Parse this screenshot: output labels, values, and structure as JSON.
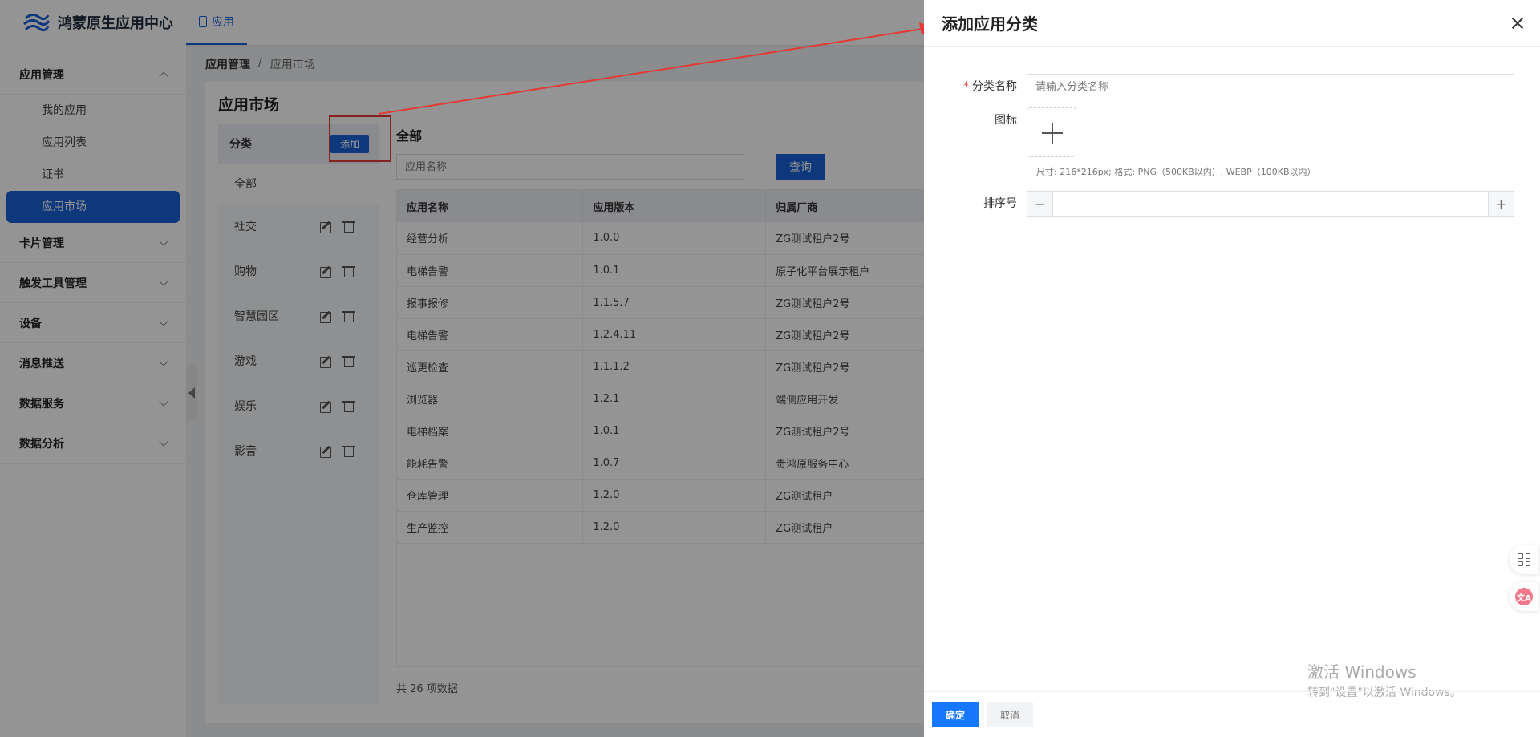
{
  "header": {
    "app_title": "鸿蒙原生应用中心",
    "tab_label": "应用"
  },
  "sidebar": {
    "groups": [
      {
        "label": "应用管理",
        "expanded": true,
        "items": [
          "我的应用",
          "应用列表",
          "证书",
          "应用市场"
        ],
        "active": "应用市场"
      },
      {
        "label": "卡片管理"
      },
      {
        "label": "触发工具管理"
      },
      {
        "label": "设备"
      },
      {
        "label": "消息推送"
      },
      {
        "label": "数据服务"
      },
      {
        "label": "数据分析"
      }
    ]
  },
  "breadcrumb": {
    "parent": "应用管理",
    "separator": "/",
    "current": "应用市场"
  },
  "main": {
    "title": "应用市场",
    "category_header": "分类",
    "add_label": "添加",
    "categories": [
      "全部",
      "社交",
      "购物",
      "智慧园区",
      "游戏",
      "娱乐",
      "影音"
    ],
    "list_title": "全部",
    "search_placeholder": "应用名称",
    "query_label": "查询",
    "columns": [
      "应用名称",
      "应用版本",
      "归属厂商"
    ],
    "rows": [
      [
        "经营分析",
        "1.0.0",
        "ZG测试租户2号"
      ],
      [
        "电梯告警",
        "1.0.1",
        "原子化平台展示租户"
      ],
      [
        "报事报修",
        "1.1.5.7",
        "ZG测试租户2号"
      ],
      [
        "电梯告警",
        "1.2.4.11",
        "ZG测试租户2号"
      ],
      [
        "巡更检查",
        "1.1.1.2",
        "ZG测试租户2号"
      ],
      [
        "浏览器",
        "1.2.1",
        "端侧应用开发"
      ],
      [
        "电梯档案",
        "1.0.1",
        "ZG测试租户2号"
      ],
      [
        "能耗告警",
        "1.0.7",
        "贵鸿原服务中心"
      ],
      [
        "仓库管理",
        "1.2.0",
        "ZG测试租户"
      ],
      [
        "生产监控",
        "1.2.0",
        "ZG测试租户"
      ]
    ],
    "total_text": "共 26 项数据"
  },
  "drawer": {
    "title": "添加应用分类",
    "name_label": "分类名称",
    "name_placeholder": "请输入分类名称",
    "icon_label": "图标",
    "icon_hint": "尺寸: 216*216px; 格式: PNG（500KB以内）, WEBP（100KB以内）",
    "sort_label": "排序号",
    "minus": "−",
    "plus": "+",
    "ok_label": "确定",
    "cancel_label": "取消"
  },
  "watermark": {
    "line1": "激活 Windows",
    "line2": "转到\"设置\"以激活 Windows。"
  },
  "float": {
    "translate_glyph": "文A"
  },
  "colors": {
    "primary": "#1a5fd6",
    "annotation": "#e53935"
  }
}
